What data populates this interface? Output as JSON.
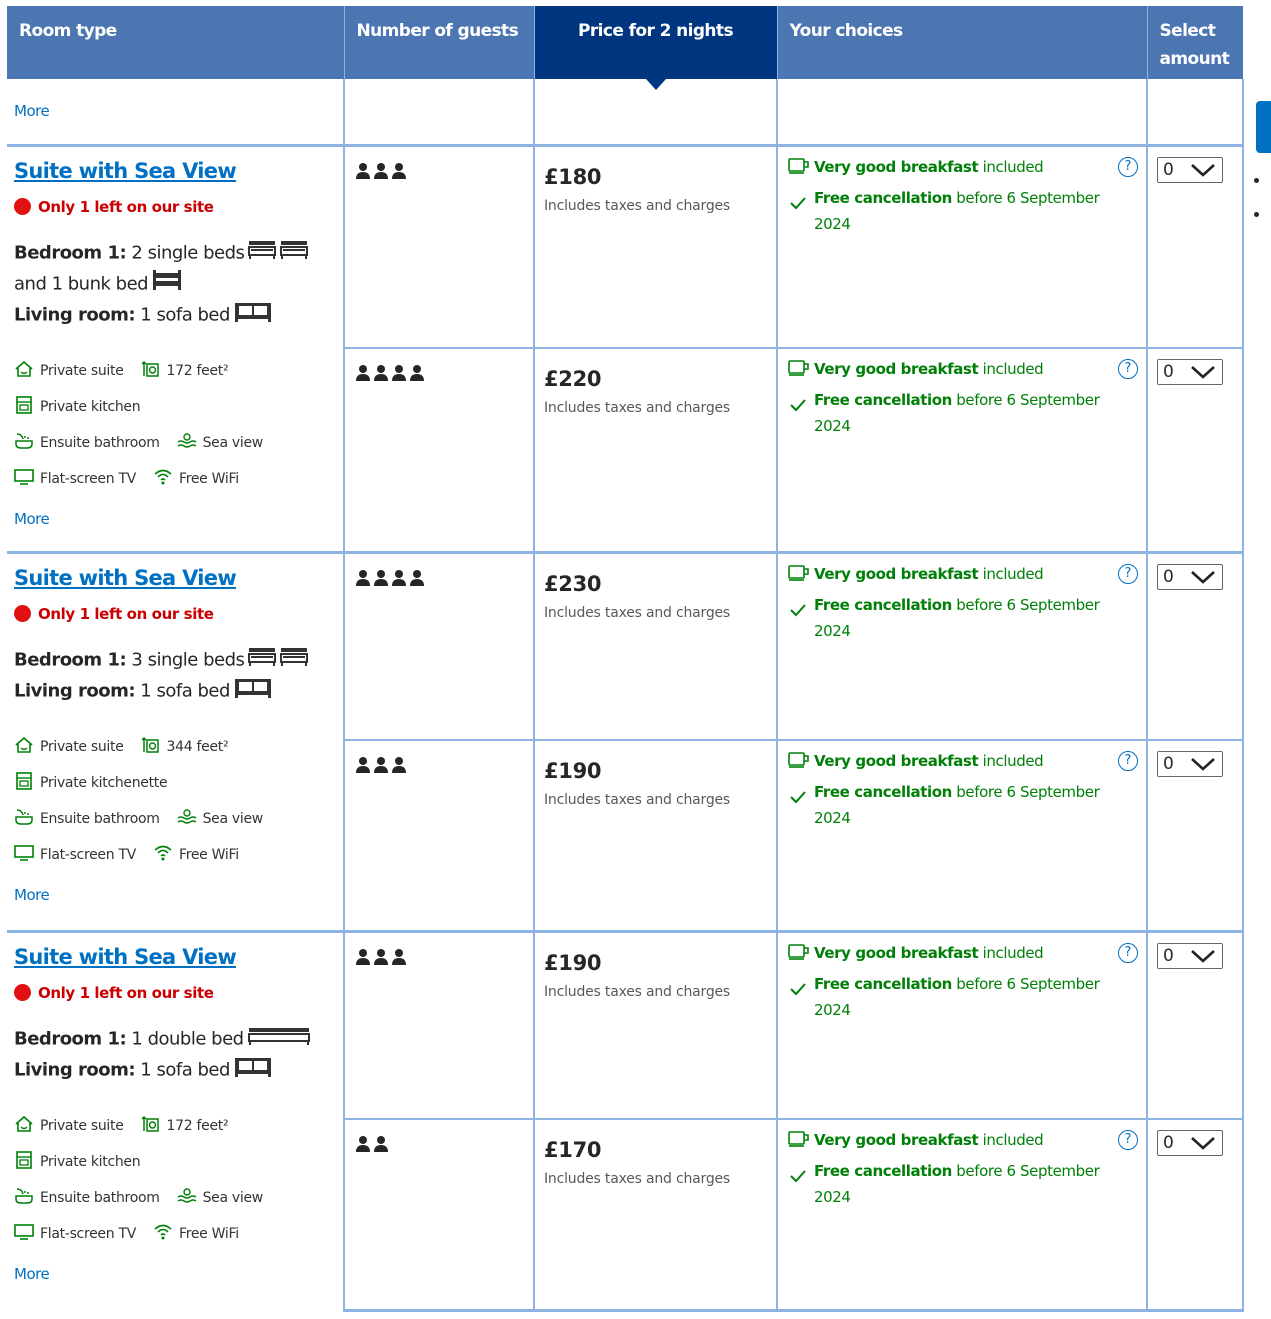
{
  "header": {
    "room_type": "Room type",
    "guests": "Number of guests",
    "price": "Price for 2 nights",
    "choices": "Your choices",
    "select": "Select amount"
  },
  "top_more": "More",
  "common": {
    "taxes": "Includes taxes and charges",
    "breakfast_bold": "Very good breakfast",
    "breakfast_rest": " included",
    "cancel_bold": "Free cancellation",
    "cancel_rest": " before 6 September 2024",
    "select_value": "0",
    "more": "More"
  },
  "rooms": [
    {
      "title": "Suite with Sea View",
      "scarcity": "Only 1 left on our site",
      "bed_lines": [
        {
          "label": "Bedroom 1:",
          "text": " 2 single beds",
          "icon": "single-bed-icon",
          "count": 2
        },
        {
          "label": "",
          "text": "and 1 bunk bed",
          "icon": "bunk-bed-icon",
          "count": 1
        },
        {
          "label": "Living room:",
          "text": " 1 sofa bed",
          "icon": "sofa-bed-icon",
          "count": 1
        }
      ],
      "facilities": {
        "private": "Private suite",
        "size": "172 feet²",
        "kitchen": "Private kitchen",
        "bathroom": "Ensuite bathroom",
        "view": "Sea view",
        "tv": "Flat-screen TV",
        "wifi": "Free WiFi"
      },
      "offers": [
        {
          "guests": 3,
          "price": "£180"
        },
        {
          "guests": 4,
          "price": "£220"
        }
      ]
    },
    {
      "title": "Suite with Sea View",
      "scarcity": "Only 1 left on our site",
      "bed_lines": [
        {
          "label": "Bedroom 1:",
          "text": " 3 single beds",
          "icon": "single-bed-icon",
          "count": 2
        },
        {
          "label": "Living room:",
          "text": " 1 sofa bed",
          "icon": "sofa-bed-icon",
          "count": 1
        }
      ],
      "facilities": {
        "private": "Private suite",
        "size": "344 feet²",
        "kitchen": "Private kitchenette",
        "bathroom": "Ensuite bathroom",
        "view": "Sea view",
        "tv": "Flat-screen TV",
        "wifi": "Free WiFi"
      },
      "offers": [
        {
          "guests": 4,
          "price": "£230"
        },
        {
          "guests": 3,
          "price": "£190"
        }
      ]
    },
    {
      "title": "Suite with Sea View",
      "scarcity": "Only 1 left on our site",
      "bed_lines": [
        {
          "label": "Bedroom 1:",
          "text": " 1 double bed",
          "icon": "double-bed-icon",
          "count": 1
        },
        {
          "label": "Living room:",
          "text": " 1 sofa bed",
          "icon": "sofa-bed-icon",
          "count": 1
        }
      ],
      "facilities": {
        "private": "Private suite",
        "size": "172 feet²",
        "kitchen": "Private kitchen",
        "bathroom": "Ensuite bathroom",
        "view": "Sea view",
        "tv": "Flat-screen TV",
        "wifi": "Free WiFi"
      },
      "offers": [
        {
          "guests": 3,
          "price": "£190"
        },
        {
          "guests": 2,
          "price": "£170"
        }
      ]
    }
  ],
  "colors": {
    "header_bg": "#4c76b2",
    "header_selected": "#003580",
    "link": "#0071c2",
    "green": "#008009",
    "red": "#cc0000",
    "border": "#8db4e3"
  }
}
